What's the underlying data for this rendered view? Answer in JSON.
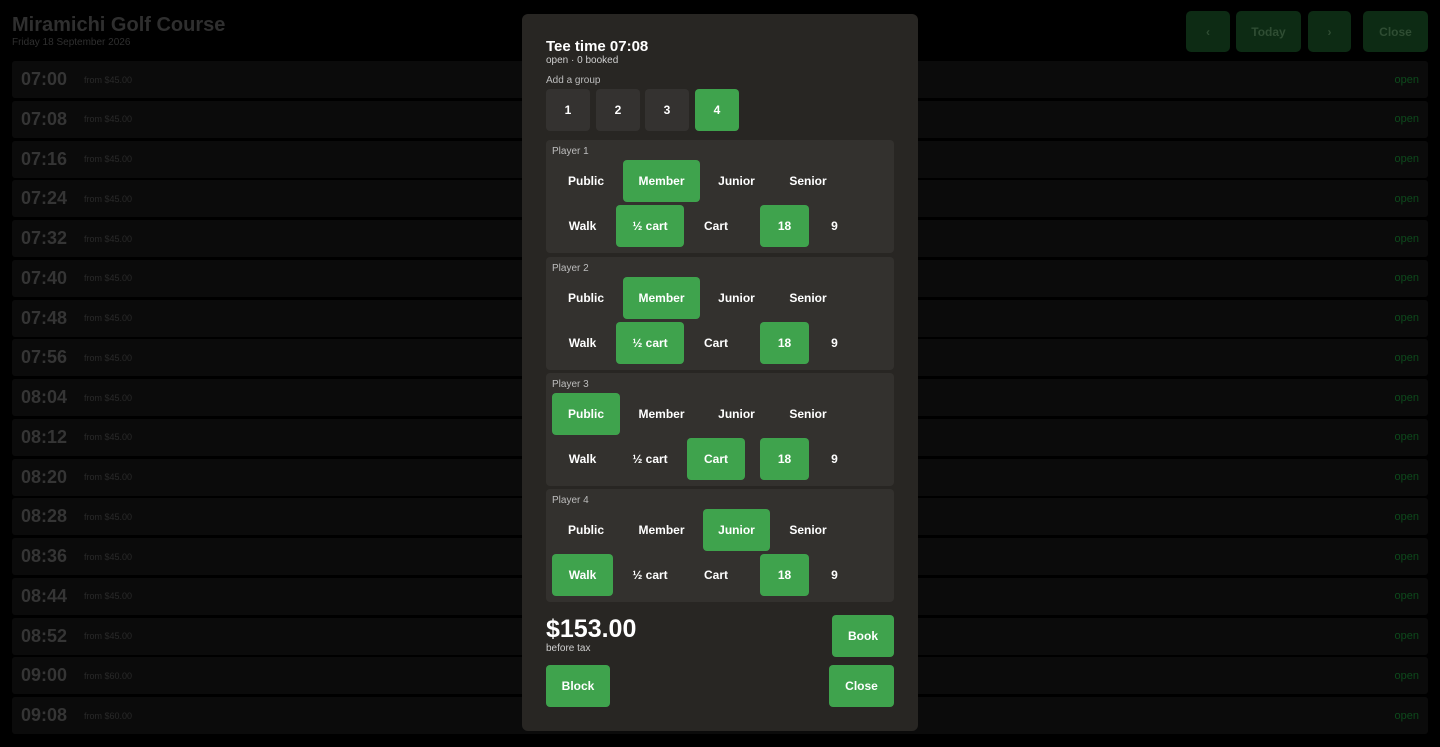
{
  "header": {
    "title": "Miramichi Golf Course",
    "date": "Friday 18 September 2026",
    "prev_label": "‹",
    "today_label": "Today",
    "next_label": "›",
    "close_label": "Close"
  },
  "tee_times": [
    {
      "time": "07:00",
      "price": "from $45.00",
      "status": "open"
    },
    {
      "time": "07:08",
      "price": "from $45.00",
      "status": "open"
    },
    {
      "time": "07:16",
      "price": "from $45.00",
      "status": "open"
    },
    {
      "time": "07:24",
      "price": "from $45.00",
      "status": "open"
    },
    {
      "time": "07:32",
      "price": "from $45.00",
      "status": "open"
    },
    {
      "time": "07:40",
      "price": "from $45.00",
      "status": "open"
    },
    {
      "time": "07:48",
      "price": "from $45.00",
      "status": "open"
    },
    {
      "time": "07:56",
      "price": "from $45.00",
      "status": "open"
    },
    {
      "time": "08:04",
      "price": "from $45.00",
      "status": "open"
    },
    {
      "time": "08:12",
      "price": "from $45.00",
      "status": "open"
    },
    {
      "time": "08:20",
      "price": "from $45.00",
      "status": "open"
    },
    {
      "time": "08:28",
      "price": "from $45.00",
      "status": "open"
    },
    {
      "time": "08:36",
      "price": "from $45.00",
      "status": "open"
    },
    {
      "time": "08:44",
      "price": "from $45.00",
      "status": "open"
    },
    {
      "time": "08:52",
      "price": "from $45.00",
      "status": "open"
    },
    {
      "time": "09:00",
      "price": "from $60.00",
      "status": "open"
    },
    {
      "time": "09:08",
      "price": "from $60.00",
      "status": "open"
    }
  ],
  "modal": {
    "title": "Tee time 07:08",
    "subtitle": "open · 0 booked",
    "add_group_label": "Add a group",
    "group_sizes": [
      "1",
      "2",
      "3",
      "4"
    ],
    "selected_group_size": "4",
    "players": [
      {
        "label": "Player 1",
        "rates": [
          "Public",
          "Member",
          "Junior",
          "Senior"
        ],
        "selected_rate": "Member",
        "transport": [
          "Walk",
          "½ cart",
          "Cart"
        ],
        "selected_transport": "½ cart",
        "holes": [
          "18",
          "9"
        ],
        "selected_holes": "18"
      },
      {
        "label": "Player 2",
        "rates": [
          "Public",
          "Member",
          "Junior",
          "Senior"
        ],
        "selected_rate": "Member",
        "transport": [
          "Walk",
          "½ cart",
          "Cart"
        ],
        "selected_transport": "½ cart",
        "holes": [
          "18",
          "9"
        ],
        "selected_holes": "18"
      },
      {
        "label": "Player 3",
        "rates": [
          "Public",
          "Member",
          "Junior",
          "Senior"
        ],
        "selected_rate": "Public",
        "transport": [
          "Walk",
          "½ cart",
          "Cart"
        ],
        "selected_transport": "Cart",
        "holes": [
          "18",
          "9"
        ],
        "selected_holes": "18"
      },
      {
        "label": "Player 4",
        "rates": [
          "Public",
          "Member",
          "Junior",
          "Senior"
        ],
        "selected_rate": "Junior",
        "transport": [
          "Walk",
          "½ cart",
          "Cart"
        ],
        "selected_transport": "Walk",
        "holes": [
          "18",
          "9"
        ],
        "selected_holes": "18"
      }
    ],
    "total": "$153.00",
    "total_note": "before tax",
    "book_label": "Book",
    "block_label": "Block",
    "close_label": "Close"
  },
  "colors": {
    "accent": "#3fa34d",
    "modal_bg": "#282623",
    "player_bg": "#33312e"
  }
}
